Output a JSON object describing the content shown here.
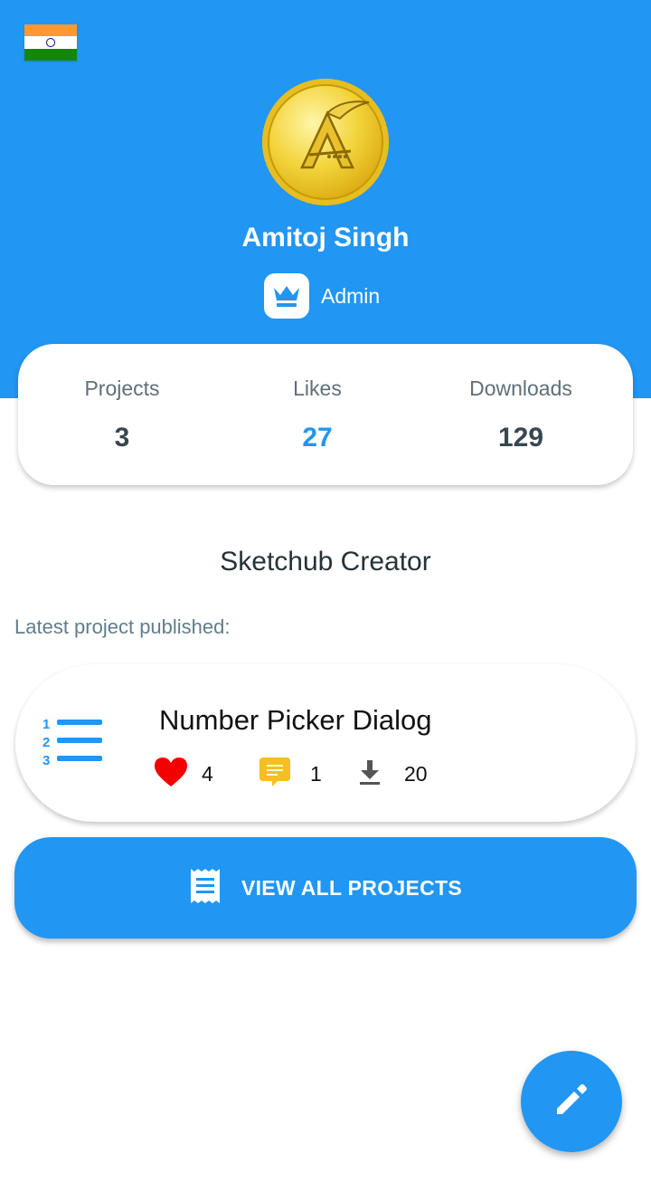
{
  "profile": {
    "name": "Amitoj Singh",
    "role": "Admin",
    "country_flag": "india-flag-icon",
    "avatar": "gold-coin-logo"
  },
  "stats": [
    {
      "label": "Projects",
      "value": "3"
    },
    {
      "label": "Likes",
      "value": "27"
    },
    {
      "label": "Downloads",
      "value": "129"
    }
  ],
  "creator_title": "Sketchub Creator",
  "latest_label": "Latest project published:",
  "latest_project": {
    "title": "Number Picker Dialog",
    "likes": "4",
    "comments": "1",
    "downloads": "20",
    "icon": "numbered-list-icon"
  },
  "view_all_button": {
    "label": "VIEW ALL PROJECTS",
    "icon": "receipt-icon"
  },
  "fab": {
    "icon": "pencil-icon"
  },
  "colors": {
    "primary": "#2196F3",
    "like": "#F40000",
    "comment": "#F4C020",
    "text_dark": "#37474F"
  }
}
